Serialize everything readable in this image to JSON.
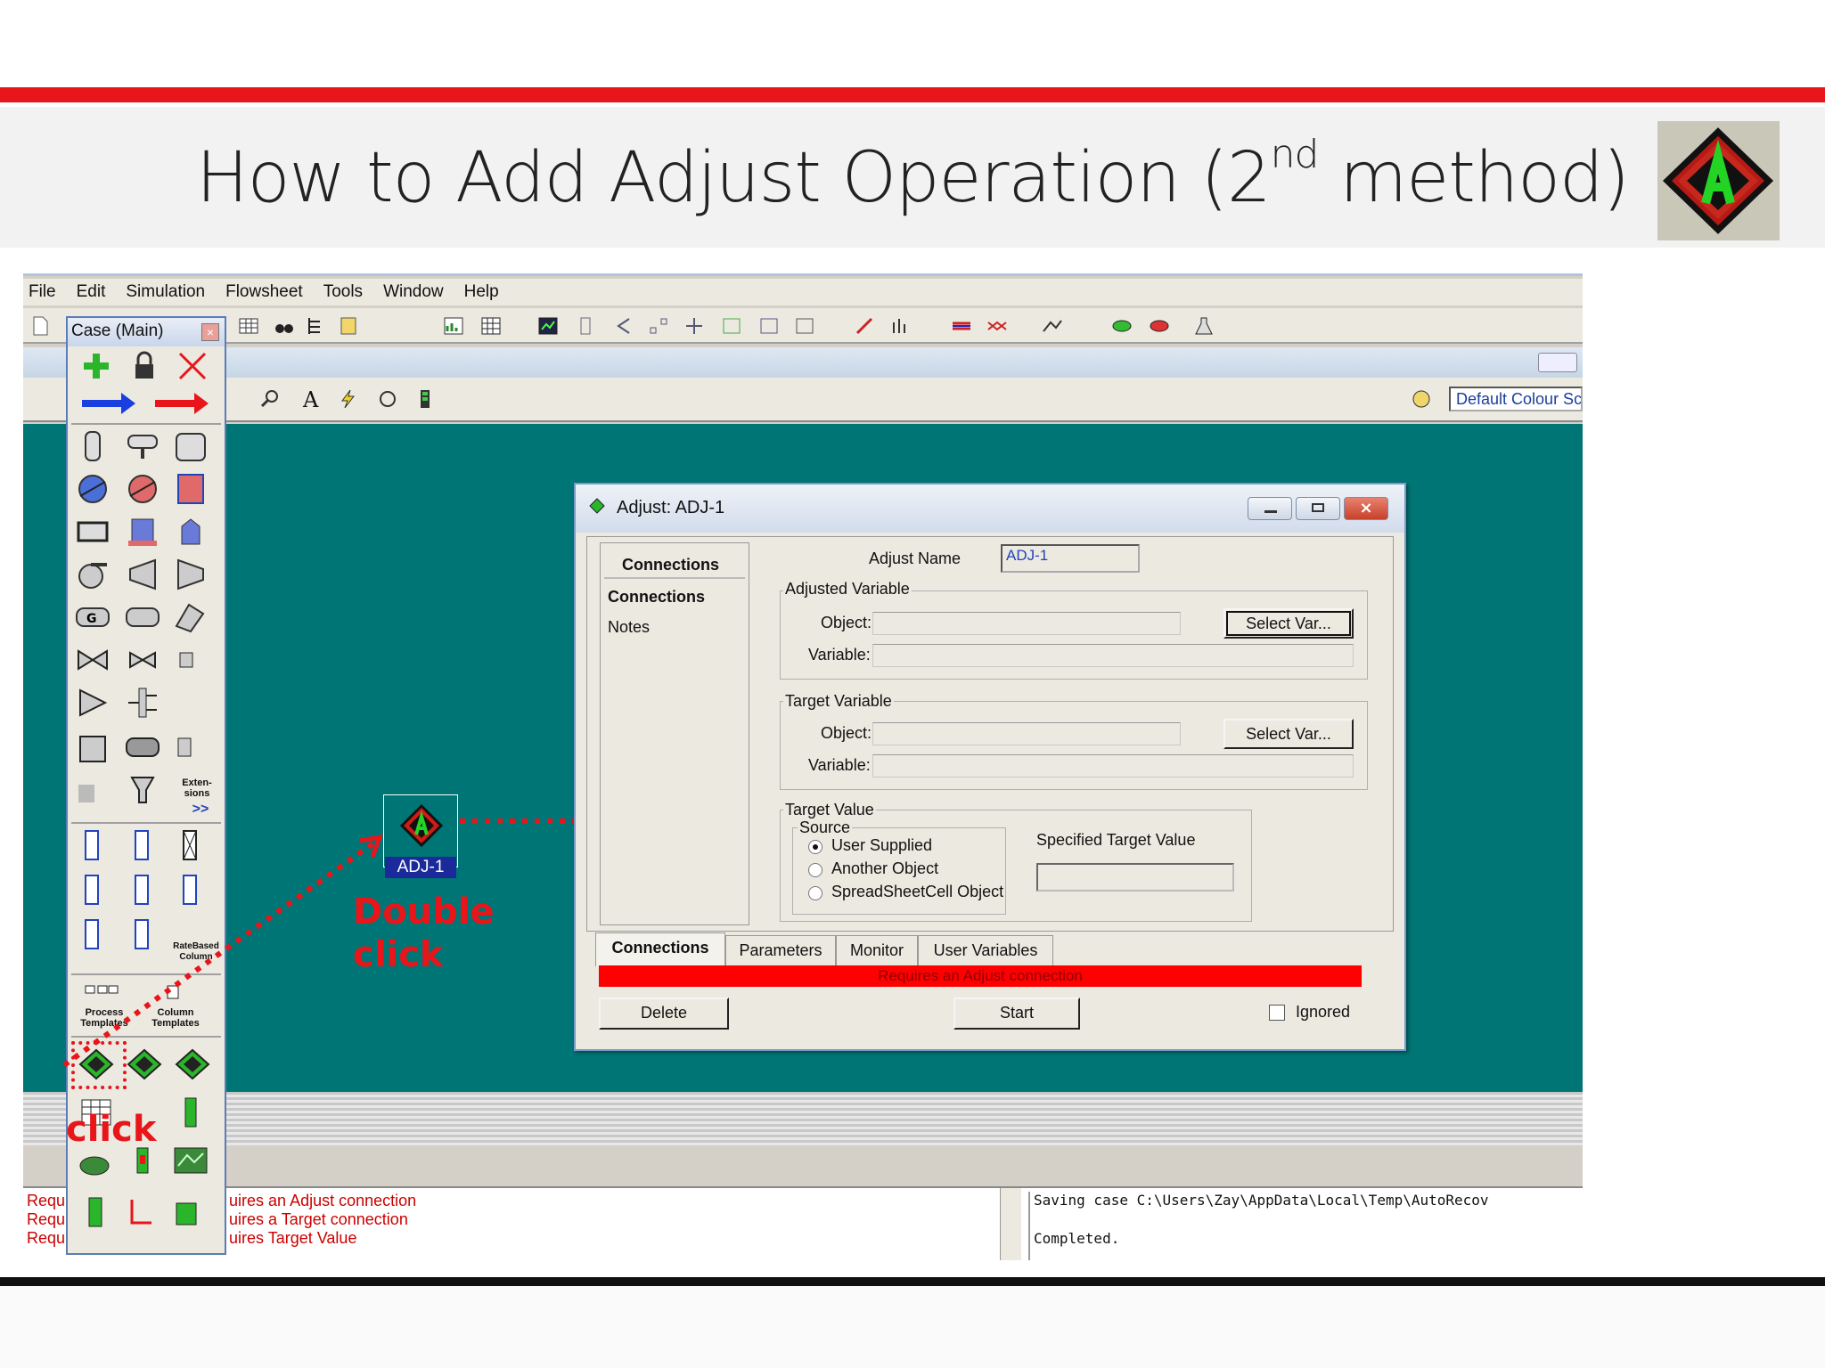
{
  "slide": {
    "title_main": "How to Add Adjust Operation (2",
    "title_sup": "nd",
    "title_end": " method)"
  },
  "menu": [
    "File",
    "Edit",
    "Simulation",
    "Flowsheet",
    "Tools",
    "Window",
    "Help"
  ],
  "colour_scheme": "Default Colour Sc",
  "palette": {
    "title": "Case (Main)",
    "labels": {
      "extensions": "Exten-\nsions",
      "extensions_more": ">>",
      "ratebased": "RateBased\nColumn",
      "process_templates": "Process\nTemplates",
      "column_templates": "Column\nTemplates"
    }
  },
  "pfd": {
    "block_label": "ADJ-1",
    "annotation_double": "Double\nclick",
    "annotation_click": "click"
  },
  "dialog": {
    "title": "Adjust: ADJ-1",
    "nav_header": "Connections",
    "nav_items": [
      "Connections",
      "Notes"
    ],
    "adjust_name_label": "Adjust Name",
    "adjust_name_value": "ADJ-1",
    "adjusted_variable": {
      "legend": "Adjusted Variable",
      "object_label": "Object:",
      "variable_label": "Variable:",
      "button": "Select Var..."
    },
    "target_variable": {
      "legend": "Target Variable",
      "object_label": "Object:",
      "variable_label": "Variable:",
      "button": "Select Var..."
    },
    "target_value": {
      "legend": "Target Value",
      "source_legend": "Source",
      "options": [
        "User Supplied",
        "Another Object",
        "SpreadSheetCell Object"
      ],
      "selected": "User Supplied",
      "specified_label": "Specified Target Value"
    },
    "tabs": [
      "Connections",
      "Parameters",
      "Monitor",
      "User Variables"
    ],
    "active_tab": "Connections",
    "status": "Requires an Adjust connection",
    "delete_button": "Delete",
    "start_button": "Start",
    "ignored_label": "Ignored"
  },
  "messages": {
    "left": [
      "Requires an Adjust connection",
      "Requires a Target connection",
      "Requires Target Value"
    ],
    "left_prefix": "Requ",
    "left_visible": [
      "uires an Adjust connection",
      "uires a Target connection",
      "uires Target Value"
    ],
    "right": [
      "Saving case C:\\Users\\Zay\\AppData\\Local\\Temp\\AutoRecov",
      "Completed."
    ]
  },
  "colors": {
    "accent_red": "#e8151b",
    "pfd_teal": "#007575",
    "status_red": "#ff0000",
    "block_label_bg": "#1a2a9a"
  }
}
